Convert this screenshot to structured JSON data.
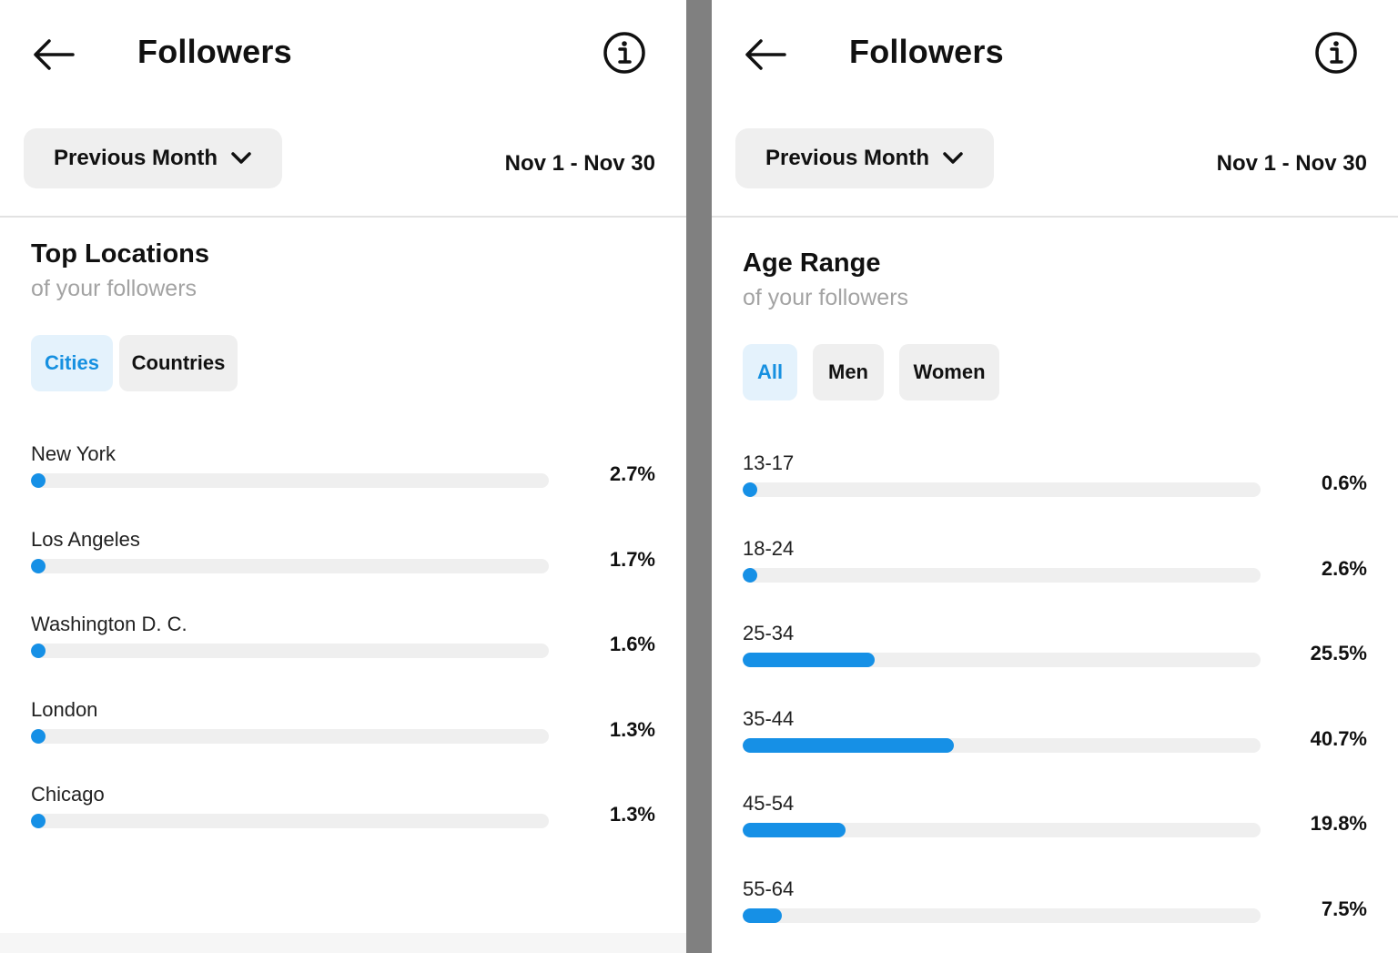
{
  "left": {
    "title": "Followers",
    "period": "Previous Month",
    "date_range": "Nov 1 - Nov 30",
    "section_title": "Top Locations",
    "section_subtitle": "of your followers",
    "filters": [
      "Cities",
      "Countries"
    ],
    "active_filter": "Cities",
    "rows": [
      {
        "label": "New York",
        "value": "2.7%",
        "fraction": 0.027
      },
      {
        "label": "Los Angeles",
        "value": "1.7%",
        "fraction": 0.017
      },
      {
        "label": "Washington D. C.",
        "value": "1.6%",
        "fraction": 0.016
      },
      {
        "label": "London",
        "value": "1.3%",
        "fraction": 0.013
      },
      {
        "label": "Chicago",
        "value": "1.3%",
        "fraction": 0.013
      }
    ]
  },
  "right": {
    "title": "Followers",
    "period": "Previous Month",
    "date_range": "Nov 1 - Nov 30",
    "section_title": "Age Range",
    "section_subtitle": "of your followers",
    "filters": [
      "All",
      "Men",
      "Women"
    ],
    "active_filter": "All",
    "rows": [
      {
        "label": "13-17",
        "value": "0.6%",
        "fraction": 0.006
      },
      {
        "label": "18-24",
        "value": "2.6%",
        "fraction": 0.026
      },
      {
        "label": "25-34",
        "value": "25.5%",
        "fraction": 0.255
      },
      {
        "label": "35-44",
        "value": "40.7%",
        "fraction": 0.407
      },
      {
        "label": "45-54",
        "value": "19.8%",
        "fraction": 0.198
      },
      {
        "label": "55-64",
        "value": "7.5%",
        "fraction": 0.075
      }
    ]
  },
  "colors": {
    "accent": "#1690e6",
    "active_chip_bg": "#e4f2fc",
    "active_chip_text": "#1690e0",
    "track": "#efefef",
    "chip": "#efefef",
    "subtitle": "#a3a3a3",
    "divider": "#808080"
  },
  "icons": {
    "back": "arrow-left-icon",
    "info": "info-circle-icon",
    "dropdown": "chevron-down-icon"
  }
}
